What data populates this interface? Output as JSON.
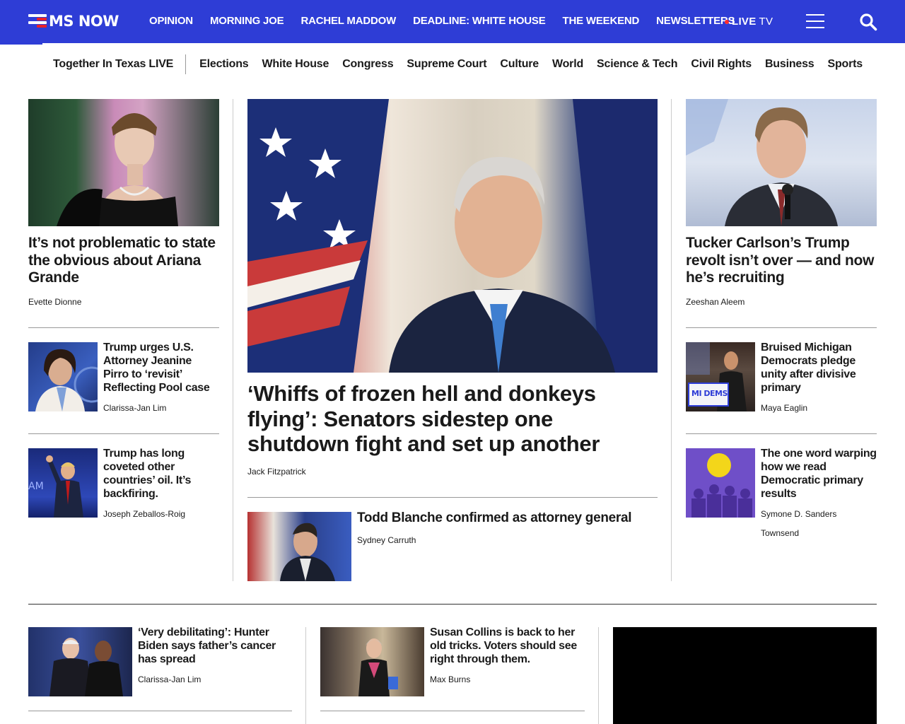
{
  "brand": {
    "name": "MS NOW"
  },
  "topnav": {
    "items": [
      "OPINION",
      "MORNING JOE",
      "RACHEL MADDOW",
      "DEADLINE: WHITE HOUSE",
      "THE WEEKEND",
      "NEWSLETTERS"
    ],
    "live": "LIVE",
    "live_suffix": "TV"
  },
  "subnav": {
    "featured": "Together In Texas LIVE",
    "items": [
      "Elections",
      "White House",
      "Congress",
      "Supreme Court",
      "Culture",
      "World",
      "Science & Tech",
      "Civil Rights",
      "Business",
      "Sports"
    ]
  },
  "left_column": {
    "lead": {
      "headline": "It’s not problematic to state the obvious about Ariana Grande",
      "byline": "Evette Dionne"
    },
    "stories": [
      {
        "headline": "Trump urges U.S. Attorney Jeanine Pirro to ‘revisit’ Reflecting Pool case",
        "byline": "Clarissa-Jan Lim"
      },
      {
        "headline": "Trump has long coveted other countries’ oil. It’s backfiring.",
        "byline": "Joseph Zeballos-Roig"
      }
    ]
  },
  "center_column": {
    "lead": {
      "headline": "‘Whiffs of frozen hell and donkeys flying’: Senators sidestep one shutdown fight and set up another",
      "byline": "Jack Fitzpatrick"
    },
    "secondary": {
      "headline": "Todd Blanche confirmed as attorney general",
      "byline": "Sydney Carruth"
    }
  },
  "right_column": {
    "lead": {
      "headline": "Tucker Carlson’s Trump revolt isn’t over — and now he’s recruiting",
      "byline": "Zeeshan Aleem"
    },
    "stories": [
      {
        "headline": "Bruised Michigan Democrats pledge unity after divisive primary",
        "byline": "Maya Eaglin",
        "image_text": "MI DEMS"
      },
      {
        "headline": "The one word warping how we read Democratic primary results",
        "byline_line1": "Symone D. Sanders",
        "byline_line2": "Townsend"
      }
    ]
  },
  "bottom_row": {
    "stories": [
      {
        "headline": "‘Very debilitating’: Hunter Biden says father’s cancer has spread",
        "byline": "Clarissa-Jan Lim"
      },
      {
        "headline": "Susan Collins is back to her old tricks. Voters should see right through them.",
        "byline": "Max Burns"
      }
    ]
  },
  "colors": {
    "brand_blue": "#2e3dd6",
    "live_red": "#ff2a2a",
    "accent_red": "#e8202a"
  }
}
